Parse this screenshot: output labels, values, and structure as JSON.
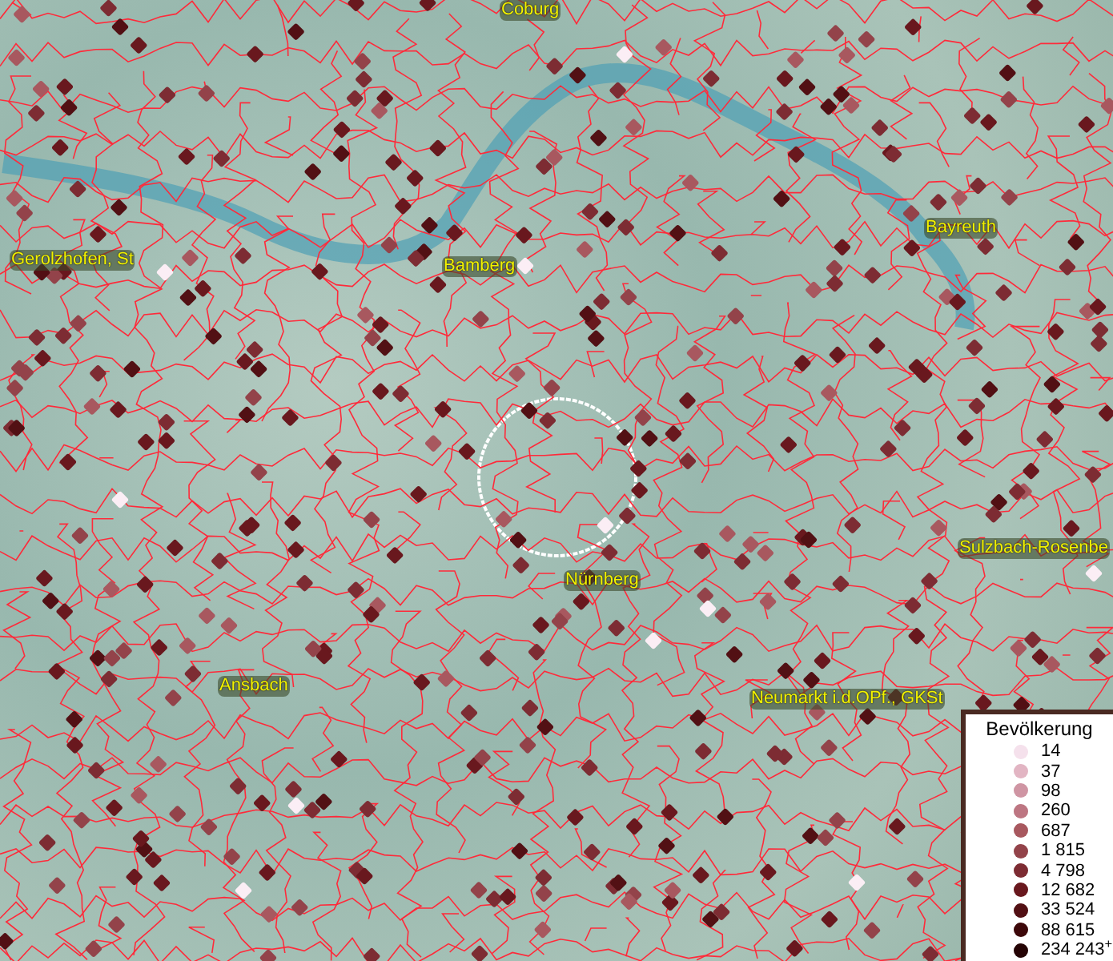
{
  "map": {
    "places": [
      {
        "name": "Coburg"
      },
      {
        "name": "Gerolzhofen, St"
      },
      {
        "name": "Bamberg"
      },
      {
        "name": "Bayreuth"
      },
      {
        "name": "Sulzbach-Rosenbe"
      },
      {
        "name": "Nürnberg"
      },
      {
        "name": "Ansbach"
      },
      {
        "name": "Neumarkt i.d.OPf., GKSt"
      }
    ]
  },
  "legend": {
    "title": "Bevölkerung",
    "items": [
      {
        "label": "14",
        "color": "#f5e1ec"
      },
      {
        "label": "37",
        "color": "#e2b5c3"
      },
      {
        "label": "98",
        "color": "#cf95a3"
      },
      {
        "label": "260",
        "color": "#bd7682"
      },
      {
        "label": "687",
        "color": "#a8585f"
      },
      {
        "label": "1 815",
        "color": "#93434a"
      },
      {
        "label": "4 798",
        "color": "#7d2c33"
      },
      {
        "label": "12 682",
        "color": "#69181e"
      },
      {
        "label": "33 524",
        "color": "#521014"
      },
      {
        "label": "88 615",
        "color": "#3d080a"
      },
      {
        "label": "234 243$^{+}$",
        "color": "#250405"
      }
    ]
  }
}
